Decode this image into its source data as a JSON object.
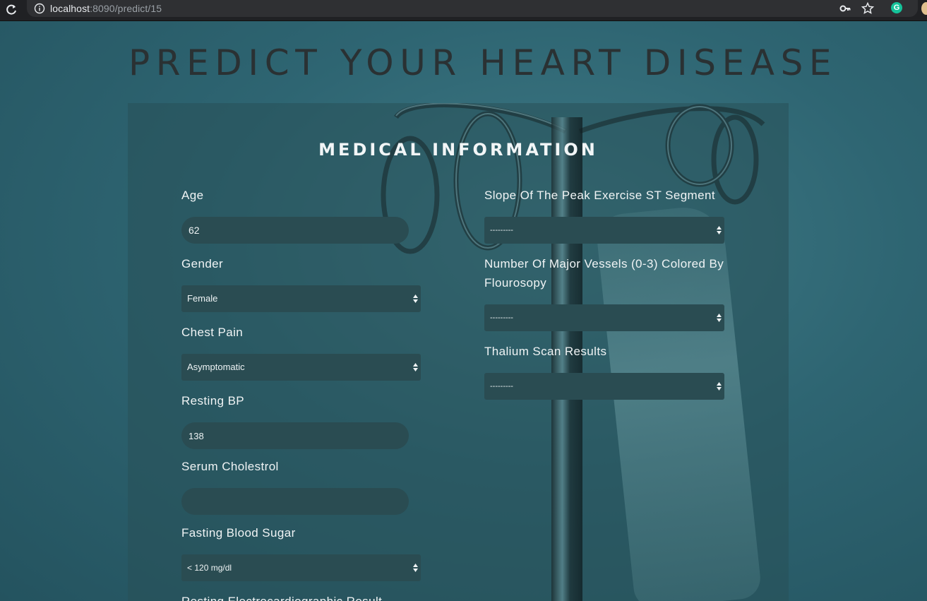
{
  "browser": {
    "url_host": "localhost",
    "url_rest": ":8090/predict/15"
  },
  "page": {
    "title": "PREDICT YOUR HEART DISEASE",
    "section_title": "MEDICAL INFORMATION"
  },
  "left_fields": {
    "age": {
      "label": "Age",
      "value": "62"
    },
    "gender": {
      "label": "Gender",
      "value": "Female"
    },
    "chest_pain": {
      "label": "Chest Pain",
      "value": "Asymptomatic"
    },
    "resting_bp": {
      "label": "Resting BP",
      "value": "138"
    },
    "serum_cholestrol": {
      "label": "Serum Cholestrol",
      "value": ""
    },
    "fasting_blood_sugar": {
      "label": "Fasting Blood Sugar",
      "value": "< 120 mg/dl"
    },
    "resting_ecg": {
      "label": "Resting Electrocardiographic Result"
    }
  },
  "right_fields": {
    "slope": {
      "label": "Slope Of The Peak Exercise ST Segment",
      "value": "---------"
    },
    "vessels": {
      "label": "Number Of Major Vessels (0-3) Colored By Flourosopy",
      "value": "---------"
    },
    "thalium": {
      "label": "Thalium Scan Results",
      "value": "---------"
    }
  },
  "colors": {
    "background": "#2e6572",
    "input_bg": "#2a4c52",
    "label_text": "#f0f4f5"
  }
}
